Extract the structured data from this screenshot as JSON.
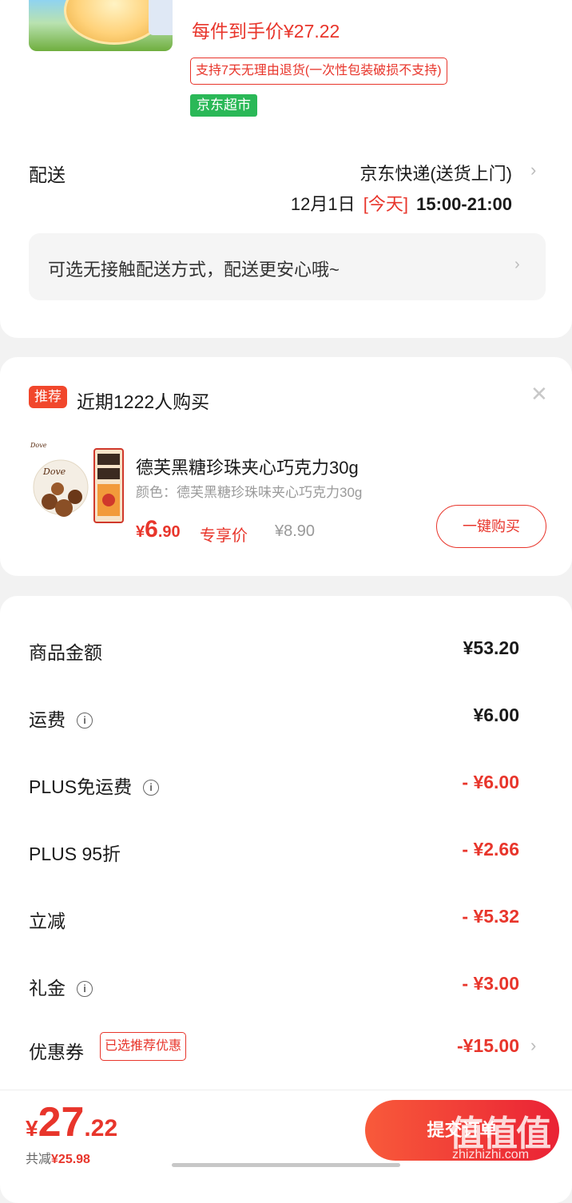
{
  "product": {
    "unit_price_label": "每件到手价¥27.22",
    "return_policy": "支持7天无理由退货(一次性包装破损不支持)",
    "store_tag": "京东超市"
  },
  "delivery": {
    "label": "配送",
    "method": "京东快递(送货上门)",
    "date": "12月1日",
    "today_tag": "[今天]",
    "time_window": "15:00-21:00",
    "contactless_tip": "可选无接触配送方式，配送更安心哦~"
  },
  "recommend": {
    "badge": "推荐",
    "title": "近期1222人购买",
    "item_name": "德芙黑糖珍珠夹心巧克力30g",
    "item_color": "颜色：德芙黑糖珍珠味夹心巧克力30g",
    "price_symbol": "¥",
    "price_int": "6",
    "price_dec": ".90",
    "exclusive_label": "专享价",
    "original_price": "¥8.90",
    "buy_button": "一键购买"
  },
  "summary": {
    "rows": [
      {
        "label": "商品金额",
        "value": "¥53.20",
        "info": false,
        "red": false
      },
      {
        "label": "运费",
        "value": "¥6.00",
        "info": true,
        "red": false
      },
      {
        "label": "PLUS免运费",
        "value": "- ¥6.00",
        "info": true,
        "red": true
      },
      {
        "label": "PLUS 95折",
        "value": "- ¥2.66",
        "info": false,
        "red": true
      },
      {
        "label": "立减",
        "value": "- ¥5.32",
        "info": false,
        "red": true
      },
      {
        "label": "礼金",
        "value": "- ¥3.00",
        "info": true,
        "red": true
      }
    ],
    "coupon_label": "优惠券",
    "coupon_tag": "已选推荐优惠",
    "coupon_value": "-¥15.00"
  },
  "bottom": {
    "currency": "¥",
    "total_int": "27",
    "total_dec": ".22",
    "saved_label": "共减",
    "saved_value": "¥25.98",
    "submit_label": "提交订单",
    "watermark": "值值值",
    "watermark_site": "zhizhizhi.com"
  },
  "colors": {
    "accent": "#e8352b",
    "store_green": "#2ab857",
    "background": "#f2f2f2"
  },
  "icons": [
    "chevron-right-icon",
    "close-icon",
    "info-icon"
  ]
}
